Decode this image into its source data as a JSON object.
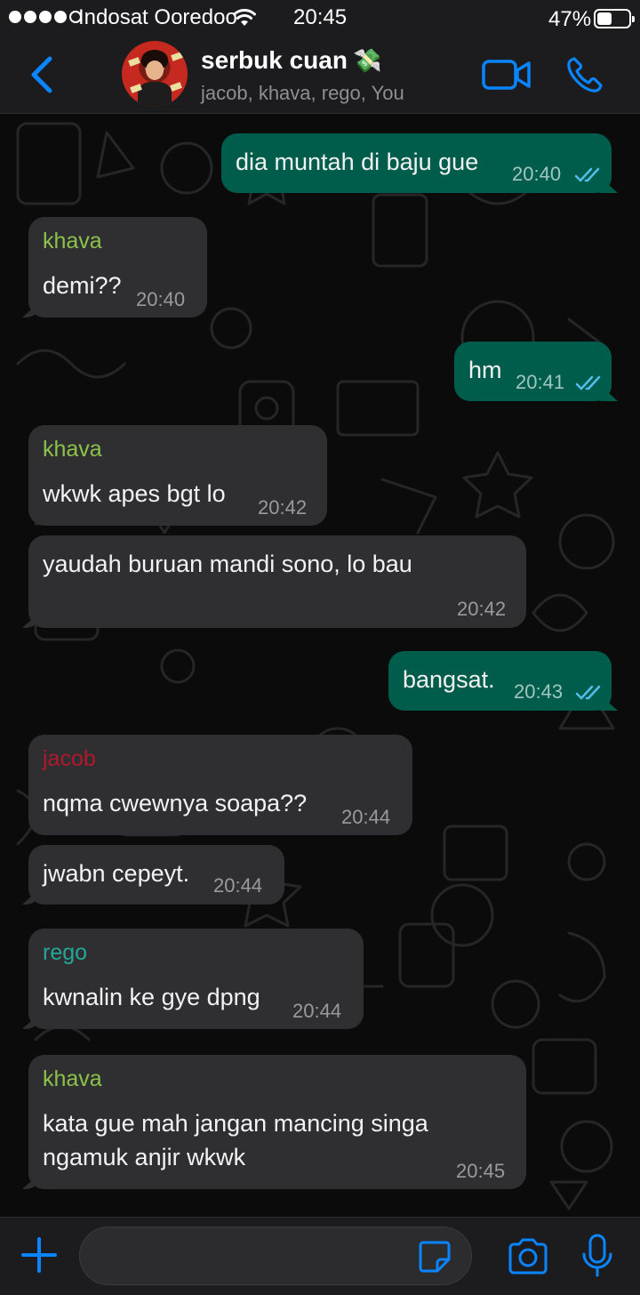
{
  "status_bar": {
    "carrier": "Indosat Ooredoo",
    "time": "20:45",
    "battery_percent": "47%",
    "battery_level": 0.47,
    "signal_bars_filled": 4,
    "signal_bars_total": 5
  },
  "header": {
    "title": "serbuk cuan",
    "title_emoji": "💸",
    "subtitle": "jacob, khava, rego, You",
    "back_icon": "chevron-left-icon",
    "video_icon": "video-camera-icon",
    "call_icon": "phone-icon"
  },
  "colors": {
    "accent": "#0a84ff",
    "outgoing_bubble": "#005c4b",
    "incoming_bubble": "#2f2f31",
    "sender_khava": "#8bc34a",
    "sender_jacob": "#b0182c",
    "sender_rego": "#26a69a",
    "read_ticks": "#53bdeb"
  },
  "messages": [
    {
      "direction": "out",
      "text": "dia muntah di baju gue",
      "time": "20:40",
      "status": "read"
    },
    {
      "direction": "in",
      "sender": "khava",
      "text": "demi??",
      "time": "20:40"
    },
    {
      "direction": "out",
      "text": "hm",
      "time": "20:41",
      "status": "read"
    },
    {
      "direction": "in",
      "sender": "khava",
      "text": "wkwk apes bgt lo",
      "time": "20:42"
    },
    {
      "direction": "in",
      "text": "yaudah buruan mandi sono, lo bau",
      "time": "20:42"
    },
    {
      "direction": "out",
      "text": "bangsat.",
      "time": "20:43",
      "status": "read"
    },
    {
      "direction": "in",
      "sender": "jacob",
      "text": "nqma cwewnya soapa??",
      "time": "20:44"
    },
    {
      "direction": "in",
      "text": "jwabn cepeyt.",
      "time": "20:44"
    },
    {
      "direction": "in",
      "sender": "rego",
      "text": "kwnalin ke gye dpng",
      "time": "20:44"
    },
    {
      "direction": "in",
      "sender": "khava",
      "text_lines": [
        "kata gue mah jangan mancing singa",
        "ngamuk anjir wkwk"
      ],
      "time": "20:45"
    }
  ],
  "input_bar": {
    "placeholder": "",
    "value": "",
    "icons": [
      "plus-icon",
      "sticker-icon",
      "camera-icon",
      "microphone-icon"
    ]
  }
}
